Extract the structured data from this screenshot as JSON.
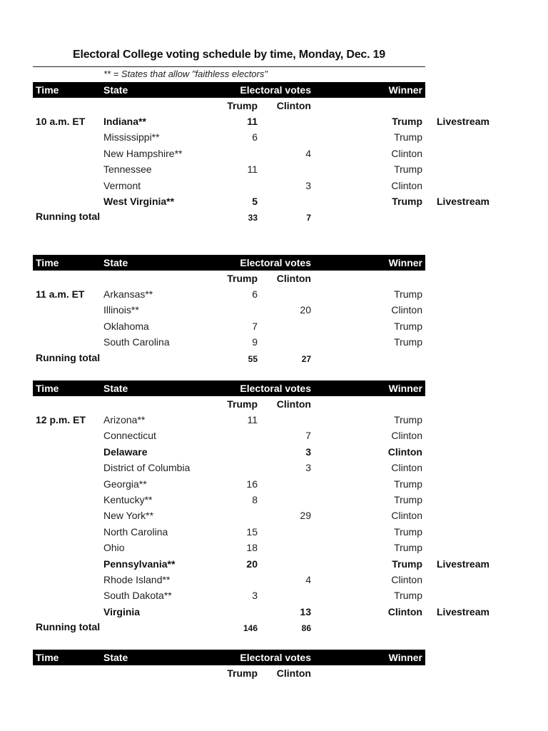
{
  "title": "Electoral College voting schedule by time, Monday, Dec. 19",
  "note": "** = States that allow \"faithless electors\"",
  "headers": {
    "time": "Time",
    "state": "State",
    "electoral_votes": "Electoral votes",
    "winner": "Winner",
    "trump": "Trump",
    "clinton": "Clinton"
  },
  "running_total_label": "Running total",
  "sections": [
    {
      "time": "10 a.m. ET",
      "rows": [
        {
          "state": "Indiana**",
          "trump": "11",
          "clinton": "",
          "winner": "Trump",
          "livestream": "Livestream",
          "bold": true
        },
        {
          "state": "Mississippi**",
          "trump": "6",
          "clinton": "",
          "winner": "Trump",
          "livestream": "",
          "bold": false
        },
        {
          "state": "New Hampshire**",
          "trump": "",
          "clinton": "4",
          "winner": "Clinton",
          "livestream": "",
          "bold": false
        },
        {
          "state": "Tennessee",
          "trump": "11",
          "clinton": "",
          "winner": "Trump",
          "livestream": "",
          "bold": false
        },
        {
          "state": "Vermont",
          "trump": "",
          "clinton": "3",
          "winner": "Clinton",
          "livestream": "",
          "bold": false
        },
        {
          "state": "West Virginia**",
          "trump": "5",
          "clinton": "",
          "winner": "Trump",
          "livestream": "Livestream",
          "bold": true
        }
      ],
      "total": {
        "trump": "33",
        "clinton": "7"
      }
    },
    {
      "time": "11 a.m. ET",
      "rows": [
        {
          "state": "Arkansas**",
          "trump": "6",
          "clinton": "",
          "winner": "Trump",
          "livestream": "",
          "bold": false
        },
        {
          "state": "Illinois**",
          "trump": "",
          "clinton": "20",
          "winner": "Clinton",
          "livestream": "",
          "bold": false
        },
        {
          "state": "Oklahoma",
          "trump": "7",
          "clinton": "",
          "winner": "Trump",
          "livestream": "",
          "bold": false
        },
        {
          "state": "South Carolina",
          "trump": "9",
          "clinton": "",
          "winner": "Trump",
          "livestream": "",
          "bold": false
        }
      ],
      "total": {
        "trump": "55",
        "clinton": "27"
      }
    },
    {
      "time": "12 p.m. ET",
      "rows": [
        {
          "state": "Arizona**",
          "trump": "11",
          "clinton": "",
          "winner": "Trump",
          "livestream": "",
          "bold": false
        },
        {
          "state": "Connecticut",
          "trump": "",
          "clinton": "7",
          "winner": "Clinton",
          "livestream": "",
          "bold": false
        },
        {
          "state": "Delaware",
          "trump": "",
          "clinton": "3",
          "winner": "Clinton",
          "livestream": "",
          "bold": true
        },
        {
          "state": "District of Columbia",
          "trump": "",
          "clinton": "3",
          "winner": "Clinton",
          "livestream": "",
          "bold": false
        },
        {
          "state": "Georgia**",
          "trump": "16",
          "clinton": "",
          "winner": "Trump",
          "livestream": "",
          "bold": false
        },
        {
          "state": "Kentucky**",
          "trump": "8",
          "clinton": "",
          "winner": "Trump",
          "livestream": "",
          "bold": false
        },
        {
          "state": "New York**",
          "trump": "",
          "clinton": "29",
          "winner": "Clinton",
          "livestream": "",
          "bold": false
        },
        {
          "state": "North Carolina",
          "trump": "15",
          "clinton": "",
          "winner": "Trump",
          "livestream": "",
          "bold": false
        },
        {
          "state": "Ohio",
          "trump": "18",
          "clinton": "",
          "winner": "Trump",
          "livestream": "",
          "bold": false
        },
        {
          "state": "Pennsylvania**",
          "trump": "20",
          "clinton": "",
          "winner": "Trump",
          "livestream": "Livestream",
          "bold": true
        },
        {
          "state": "Rhode Island**",
          "trump": "",
          "clinton": "4",
          "winner": "Clinton",
          "livestream": "",
          "bold": false
        },
        {
          "state": "South Dakota**",
          "trump": "3",
          "clinton": "",
          "winner": "Trump",
          "livestream": "",
          "bold": false
        },
        {
          "state": "Virginia",
          "trump": "",
          "clinton": "13",
          "winner": "Clinton",
          "livestream": "Livestream",
          "bold": true
        }
      ],
      "total": {
        "trump": "146",
        "clinton": "86"
      }
    },
    {
      "time": "",
      "rows": [],
      "total": null
    }
  ]
}
